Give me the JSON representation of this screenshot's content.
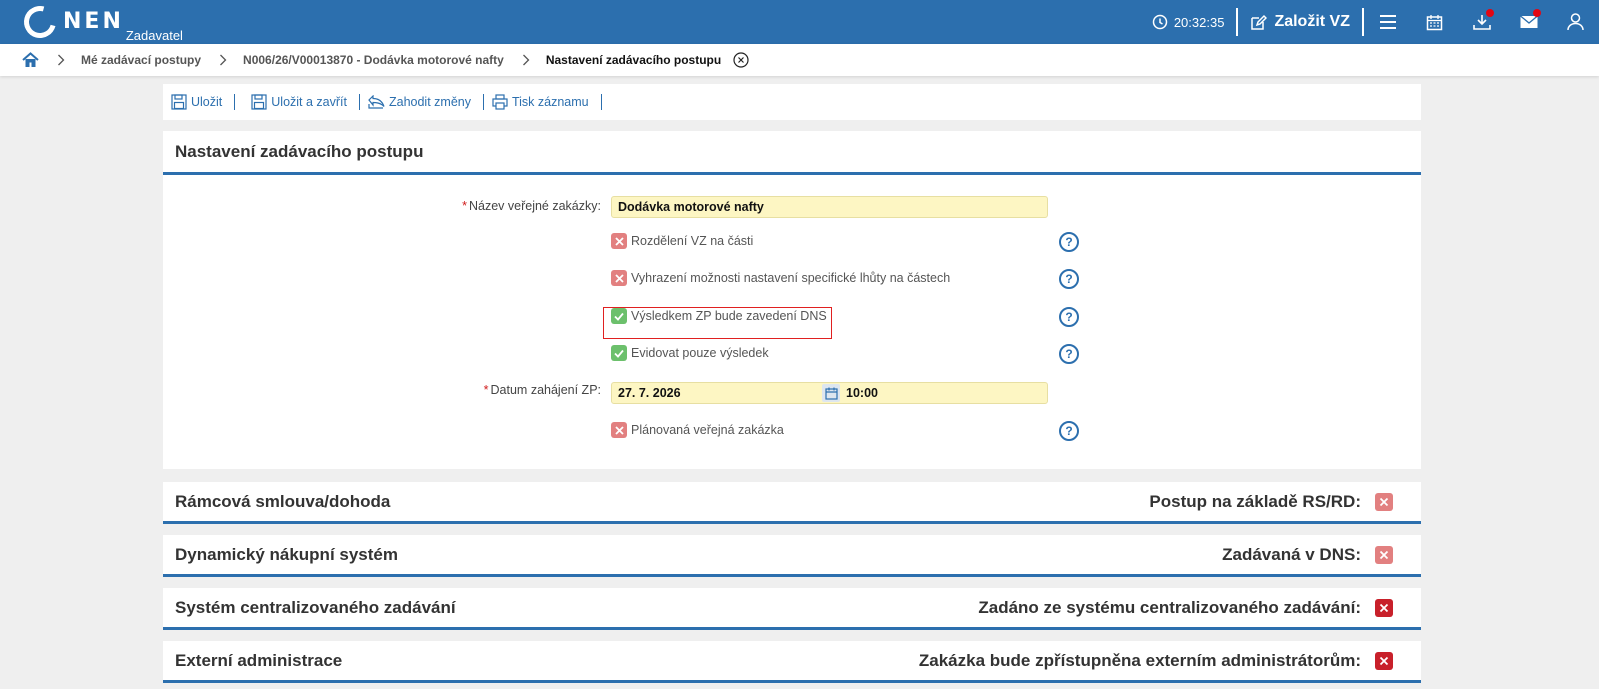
{
  "header": {
    "logo_text": "NEN",
    "logo_sub": "Zadavatel",
    "time": "20:32:35",
    "create_label": "Založit VZ",
    "brand_color": "#2c6fae",
    "icons": [
      "menu-icon",
      "calendar-icon",
      "download-icon",
      "mail-icon",
      "user-icon"
    ]
  },
  "breadcrumb": {
    "items": [
      "Mé zadávací postupy",
      "N006/26/V00013870 - Dodávka motorové nafty",
      "Nastavení zadávacího postupu"
    ]
  },
  "toolbar": {
    "save": "Uložit",
    "save_close": "Uložit a zavřít",
    "discard": "Zahodit změny",
    "print": "Tisk záznamu"
  },
  "form": {
    "title": "Nastavení zadávacího postupu",
    "name_label": "Název veřejné zakázky:",
    "name_value": "Dodávka motorové nafty",
    "checkboxes": [
      {
        "label": "Rozdělení VZ na části",
        "checked": false
      },
      {
        "label": "Vyhrazení možnosti nastavení specifické lhůty na částech",
        "checked": false
      },
      {
        "label": "Výsledkem ZP bude zavedení DNS",
        "checked": true
      },
      {
        "label": "Evidovat pouze výsledek",
        "checked": true
      }
    ],
    "date_label": "Datum zahájení ZP:",
    "date_value": "27. 7. 2026",
    "time_value": "10:00",
    "planned_label": "Plánovaná veřejná zakázka",
    "planned_checked": false,
    "help_glyph": "?"
  },
  "sections": [
    {
      "title": "Rámcová smlouva/dohoda",
      "right_label": "Postup na základě RS/RD:",
      "state": "light"
    },
    {
      "title": "Dynamický nákupní systém",
      "right_label": "Zadávaná v DNS:",
      "state": "light"
    },
    {
      "title": "Systém centralizovaného zadávání",
      "right_label": "Zadáno ze systému centralizovaného zadávání:",
      "state": "dark"
    },
    {
      "title": "Externí administrace",
      "right_label": "Zakázka bude zpřístupněna externím administrátorům:",
      "state": "dark"
    }
  ]
}
